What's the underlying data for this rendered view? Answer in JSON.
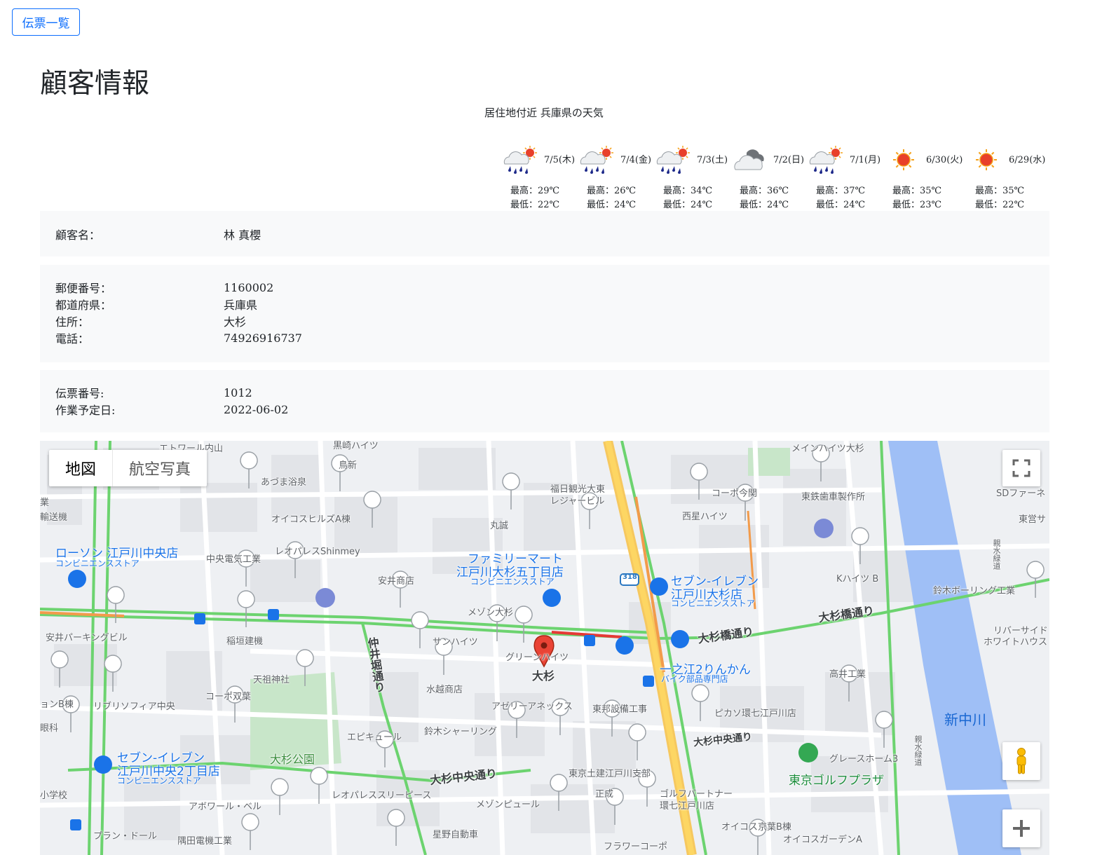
{
  "nav": {
    "list_button": "伝票一覧"
  },
  "page": {
    "title": "顧客情報"
  },
  "weather": {
    "caption": "居住地付近 兵庫県の天気",
    "days": [
      {
        "date": "7/5(木)",
        "high": "最高：29℃",
        "low": "最低：22℃",
        "icon": "sun-rain-icon"
      },
      {
        "date": "7/4(金)",
        "high": "最高：26℃",
        "low": "最低：24℃",
        "icon": "sun-rain-icon"
      },
      {
        "date": "7/3(土)",
        "high": "最高：34℃",
        "low": "最低：24℃",
        "icon": "sun-rain-icon"
      },
      {
        "date": "7/2(日)",
        "high": "最高：36℃",
        "low": "最低：24℃",
        "icon": "cloud-icon"
      },
      {
        "date": "7/1(月)",
        "high": "最高：37℃",
        "low": "最低：24℃",
        "icon": "sun-rain-icon"
      },
      {
        "date": "6/30(火)",
        "high": "最高：35℃",
        "low": "最低：23℃",
        "icon": "sun-icon"
      },
      {
        "date": "6/29(水)",
        "high": "最高：35℃",
        "low": "最低：22℃",
        "icon": "sun-icon"
      }
    ]
  },
  "customer": {
    "name_label": "顧客名：",
    "name": "林 真櫻",
    "postal_label": "郵便番号：",
    "postal": "1160002",
    "pref_label": "都道府県：",
    "pref": "兵庫県",
    "address_label": "住所：",
    "address": "大杉",
    "phone_label": "電話：",
    "phone": "74926916737"
  },
  "slip": {
    "number_label": "伝票番号:",
    "number": "1012",
    "date_label": "作業予定日:",
    "date": "2022-06-02"
  },
  "map": {
    "type_map": "地図",
    "type_satellite": "航空写真",
    "marker_label": "大杉",
    "road_labels": {
      "oosugi_bashi": "大杉橋通り",
      "oosugi_bashi2": "大杉橋通り",
      "oosugi_chuo": "大杉中央通り",
      "oosugi_chuo2": "大杉中央通り",
      "nakaibori": "仲井堀通り",
      "route": "318"
    },
    "poi": {
      "lawson": "ローソン 江戸川中央店",
      "lawson_sub": "コンビニエンスストア",
      "familymart": "ファミリーマート",
      "familymart2": "江戸川大杉五丁目店",
      "familymart_sub": "コンビニエンスストア",
      "seven1": "セブン-イレブン",
      "seven1b": "江戸川大杉店",
      "seven1_sub": "コンビニエンスストア",
      "seven2": "セブン-イレブン",
      "seven2b": "江戸川中央2丁目店",
      "seven2_sub": "コンビニエンスストア",
      "ichinoe": "一之江2りんかん",
      "ichinoe_sub": "バイク部品専門店",
      "golf": "東京ゴルフプラザ",
      "park": "大杉公園",
      "river": "新中川",
      "p01": "あづま浴泉",
      "p02": "オイコスヒルズA棟",
      "p03": "中央電気工業",
      "p04": "レオパレスShinmey",
      "p05": "安井商店",
      "p06": "丸誠",
      "p07": "福日観光大東",
      "p08": "レジャービル",
      "p09": "コーポ今関",
      "p10": "西星ハイツ",
      "p11": "東鉄歯車製作所",
      "p12": "メインハイツ大杉",
      "p13": "Kハイツ B",
      "p14": "鈴木ボーリング工業",
      "p15": "メゾン大杉",
      "p16": "サンハイツ",
      "p17": "グリーンハイツ",
      "p18": "安井パーキングビル",
      "p19": "稲垣建機",
      "p20": "天祖神社",
      "p21": "コーポ双葉",
      "p22": "リブリソフィア中央",
      "p23": "水越商店",
      "p24": "アゼリーアネックス",
      "p25": "東邦設備工事",
      "p26": "ピカソ環七江戸川店",
      "p27": "高井工業",
      "p28": "リバーサイド",
      "p29": "ホワイトハウス",
      "p30": "エピキュール",
      "p31": "鈴木シャーリング",
      "p32": "東京土建江戸川支部",
      "p33": "グレースホーム3",
      "p34": "レオパレススリーピース",
      "p35": "アボワール・ベル",
      "p36": "メゾンピュール",
      "p37": "正成",
      "p38": "ゴルフパートナー",
      "p39": "環七江戸川店",
      "p40": "オイコス京葉B棟",
      "p41": "オイコスガーデンA",
      "p42": "プラン・ドール",
      "p43": "隅田電機工業",
      "p44": "星野自動車",
      "p45": "フラワーコーポ",
      "p46": "エトワール内山",
      "p47": "黒崎ハイツ",
      "p48": "鳥新",
      "p49": "SDファーネ",
      "p50": "東営サ",
      "p51": "ョンB棟",
      "p52": "眼科",
      "p53": "小学校",
      "p54": "業",
      "p55": "輸送機",
      "p56": "親水緑道",
      "p57": "親水緑道"
    }
  }
}
